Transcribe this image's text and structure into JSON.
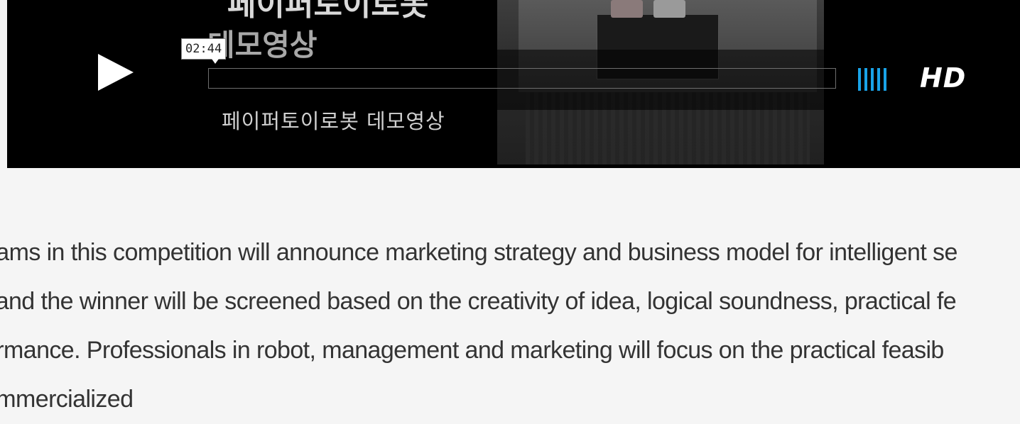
{
  "player": {
    "title_line1": "페이퍼토이로봇",
    "title_line2": "데모영상",
    "caption": "페이퍼토이로봇 데모영상",
    "time_tooltip": "02:44",
    "progress": 0,
    "volume_bars": 5,
    "hd_label": "HD",
    "colors": {
      "background": "#000000",
      "volume": "#19a3e8",
      "text": "#ffffff"
    }
  },
  "article": {
    "lines": [
      "eams in this competition will announce marketing strategy and business model for intelligent se",
      ", and the winner will be screened based on the creativity of idea, logical soundness, practical fe",
      "ormance. Professionals in robot, management and marketing will focus on the practical feasib",
      "ommercialized"
    ]
  }
}
